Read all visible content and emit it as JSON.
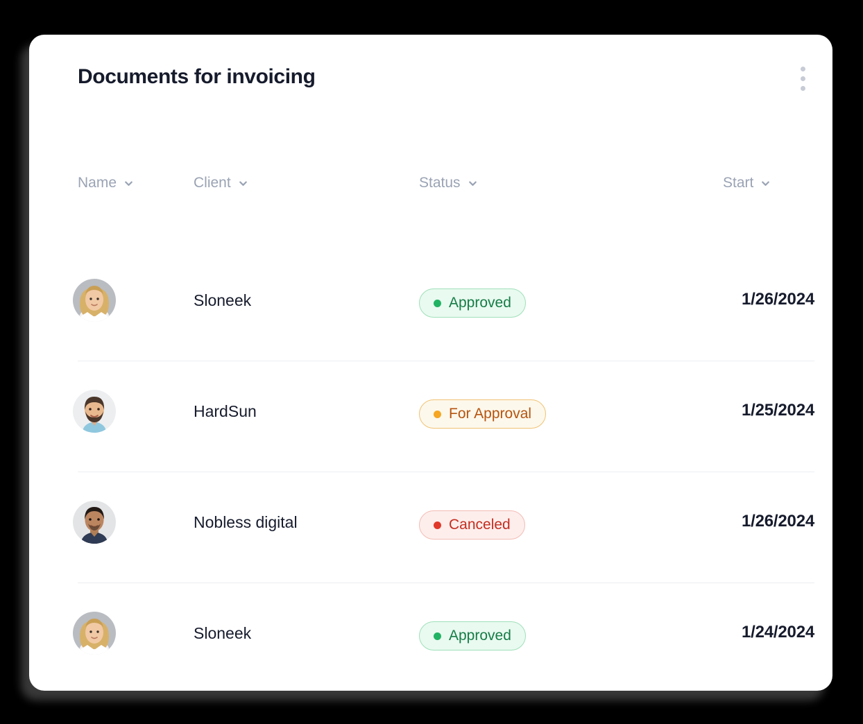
{
  "card": {
    "title": "Documents for invoicing",
    "menu_icon": "kebab-menu-icon"
  },
  "columns": [
    {
      "label": "Name",
      "icon": "chevron-down-icon"
    },
    {
      "label": "Client",
      "icon": "chevron-down-icon"
    },
    {
      "label": "Status",
      "icon": "chevron-down-icon"
    },
    {
      "label": "Start",
      "icon": "chevron-down-icon"
    }
  ],
  "rows": [
    {
      "avatar": "avatar-blonde-woman",
      "client": "Sloneek",
      "status": {
        "label": "Approved",
        "type": "approved"
      },
      "start": "1/26/2024"
    },
    {
      "avatar": "avatar-bearded-man",
      "client": "HardSun",
      "status": {
        "label": "For Approval",
        "type": "for-approval"
      },
      "start": "1/25/2024"
    },
    {
      "avatar": "avatar-dark-haired-man",
      "client": "Nobless digital",
      "status": {
        "label": "Canceled",
        "type": "canceled"
      },
      "start": "1/26/2024"
    },
    {
      "avatar": "avatar-blonde-woman",
      "client": "Sloneek",
      "status": {
        "label": "Approved",
        "type": "approved"
      },
      "start": "1/24/2024"
    }
  ],
  "colors": {
    "page_background": "#000000",
    "card_background": "#ffffff",
    "title": "#161b2c",
    "column_header": "#9aa3b4",
    "divider": "#eceef2",
    "menu_dot": "#c7cbd6",
    "approved_text": "#157c46",
    "approved_dot": "#21b363",
    "approved_bg": "#e9faf0",
    "for_approval_text": "#b5540f",
    "for_approval_dot": "#f5a623",
    "for_approval_bg": "#fdf8ec",
    "canceled_text": "#c42d20",
    "canceled_dot": "#e0382a",
    "canceled_bg": "#fdeeec"
  }
}
